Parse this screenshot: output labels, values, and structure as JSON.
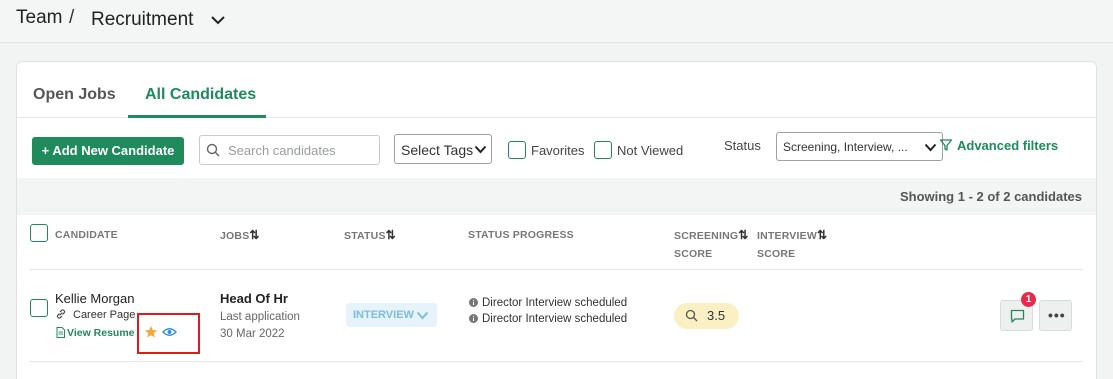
{
  "breadcrumb": {
    "root": "Team",
    "separator": "/",
    "current": "Recruitment"
  },
  "tabs": [
    {
      "label": "Open Jobs",
      "active": false
    },
    {
      "label": "All Candidates",
      "active": true
    }
  ],
  "toolbar": {
    "add_label": "+ Add New Candidate",
    "search_placeholder": "Search candidates",
    "search_value": "",
    "tags_label": "Select Tags",
    "favorites_label": "Favorites",
    "favorites_checked": false,
    "not_viewed_label": "Not Viewed",
    "not_viewed_checked": false,
    "status_label": "Status",
    "status_value": "Screening, Interview, ...",
    "advanced_label": "Advanced filters"
  },
  "results": {
    "showing": "Showing 1 - 2 of 2 candidates"
  },
  "table": {
    "headers": {
      "candidate": "CANDIDATE",
      "jobs": "JOBS",
      "status": "STATUS",
      "status_progress": "STATUS PROGRESS",
      "screening_score_1": "SCREENING",
      "screening_score_2": "SCORE",
      "interview_score_1": "INTERVIEW",
      "interview_score_2": "SCORE"
    },
    "rows": [
      {
        "name": "Kellie Morgan",
        "source": "Career Page",
        "view_resume": "View Resume",
        "favorited": true,
        "viewed": true,
        "job": "Head Of Hr",
        "last_application_label": "Last application",
        "last_application_date": "30 Mar 2022",
        "status": "INTERVIEW",
        "progress": [
          "Director Interview scheduled",
          "Director Interview scheduled"
        ],
        "screening_score": "3.5",
        "interview_score": "",
        "comment_count": "1"
      }
    ]
  },
  "colors": {
    "accent": "#1f8a5c",
    "highlight_box": "#e01b1b",
    "status_pill_bg": "#e6f3fa",
    "score_pill_bg": "#fbefc4",
    "badge": "#e8294c",
    "star": "#f2a93b",
    "eye": "#3a8fd6"
  }
}
